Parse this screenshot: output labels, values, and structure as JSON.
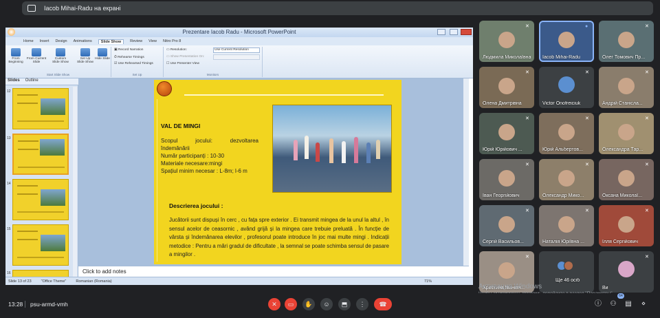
{
  "banner": {
    "text": "Iacob Mihai-Radu на екрані"
  },
  "ppt": {
    "window_title": "Prezentare Iacob Radu - Microsoft PowerPoint",
    "tabs": [
      "Home",
      "Insert",
      "Design",
      "Animations",
      "Slide Show",
      "Review",
      "View",
      "Nitro Pro 8"
    ],
    "ribbon": {
      "from_beginning": "From Beginning",
      "from_current": "From Current Slide",
      "custom_show": "Custom Slide Show",
      "setup_show": "Set Up Slide Show",
      "hide_slide": "Hide Slide",
      "record_narration": "Record Narration",
      "rehearse_timings": "Rehearse Timings",
      "use_rehearsed": "Use Rehearsed Timings",
      "resolution": "Resolution:",
      "resolution_value": "Use Current Resolution",
      "show_presentation_on": "Show Presentation On:",
      "use_presenter_view": "Use Presenter View",
      "group_start": "Start Slide Show",
      "group_setup": "Set Up",
      "group_monitors": "Monitors"
    },
    "pane_tabs": [
      "Slides",
      "Outline"
    ],
    "thumb_numbers": [
      "12",
      "13",
      "14",
      "15",
      "16"
    ],
    "slide": {
      "game_title": "VAL DE MINGI",
      "purpose_label": "Scopul",
      "purpose_word": "jocului:",
      "purpose_value": "dezvoltarea",
      "purpose_line2": "îndemânării",
      "participants": "Număr participanți : 10-30",
      "materials": "Materiale necesare:mingi",
      "space": "Spațiul minim necesar : L-8m; l-6 m",
      "desc_title": "Descrierea jocului :",
      "desc_body": "Jucătorii sunt dispuși în cerc , cu fața spre exterior . Ei transmit mingea de la unul la altul , în sensul acelor de ceasornic , având grijă și la mingea care trebuie preluată . În funcție de vârsta și îndemânarea elevilor , profesorul poate introduce în joc mai multe mingi . Indicații metodice : Pentru a mări gradul de dificultate , la semnal se poate schimba sensul de pasare a mingilor ."
    },
    "notes_placeholder": "Click to add notes",
    "status": {
      "slide": "Slide 13 of 23",
      "theme": "\"Office Theme\"",
      "language": "Romanian (Romania)",
      "zoom": "71%"
    }
  },
  "participants": [
    {
      "name": "Людмила Миколаївна",
      "mic": "off"
    },
    {
      "name": "Iacob Mihai-Radu",
      "mic": "on",
      "speaking": true
    },
    {
      "name": "Олег Томович Пр...",
      "mic": "off"
    },
    {
      "name": "Олена Дмитрівна",
      "mic": "off"
    },
    {
      "name": "Victor Onofreiciuk",
      "mic": "off",
      "avatar": true
    },
    {
      "name": "Андрій Станісла...",
      "mic": "off"
    },
    {
      "name": "Юрій Юрійович ...",
      "mic": "off"
    },
    {
      "name": "Юрій Альбертов...",
      "mic": "off"
    },
    {
      "name": "Олександра Тар...",
      "mic": "off"
    },
    {
      "name": "Іван Георгійович",
      "mic": "off"
    },
    {
      "name": "Олександр Мико...",
      "mic": "off"
    },
    {
      "name": "Оксана Миколаї...",
      "mic": "off"
    },
    {
      "name": "Сергій Васильов...",
      "mic": "off"
    },
    {
      "name": "Наталія Юріївна ...",
      "mic": "off"
    },
    {
      "name": "Ілля Сергійович",
      "mic": "off"
    },
    {
      "name": "Христина Іванівн...",
      "mic": "off"
    },
    {
      "name": "Ще 46 осіб",
      "mic": "none",
      "more": true
    },
    {
      "name": "Ви",
      "mic": "off",
      "avatar": true
    }
  ],
  "watermark": {
    "line1": "Активация Windows",
    "line2": "Чтобы активировать Windows, перейдите в раздел \"Параметры\"."
  },
  "bottom": {
    "time": "13:28",
    "meeting_code": "psu-armd-vmh",
    "participant_count": "64"
  },
  "colors": {
    "danger": "#ea4335",
    "slide_bg": "#f2d51f",
    "accent": "#8ab4f8"
  }
}
